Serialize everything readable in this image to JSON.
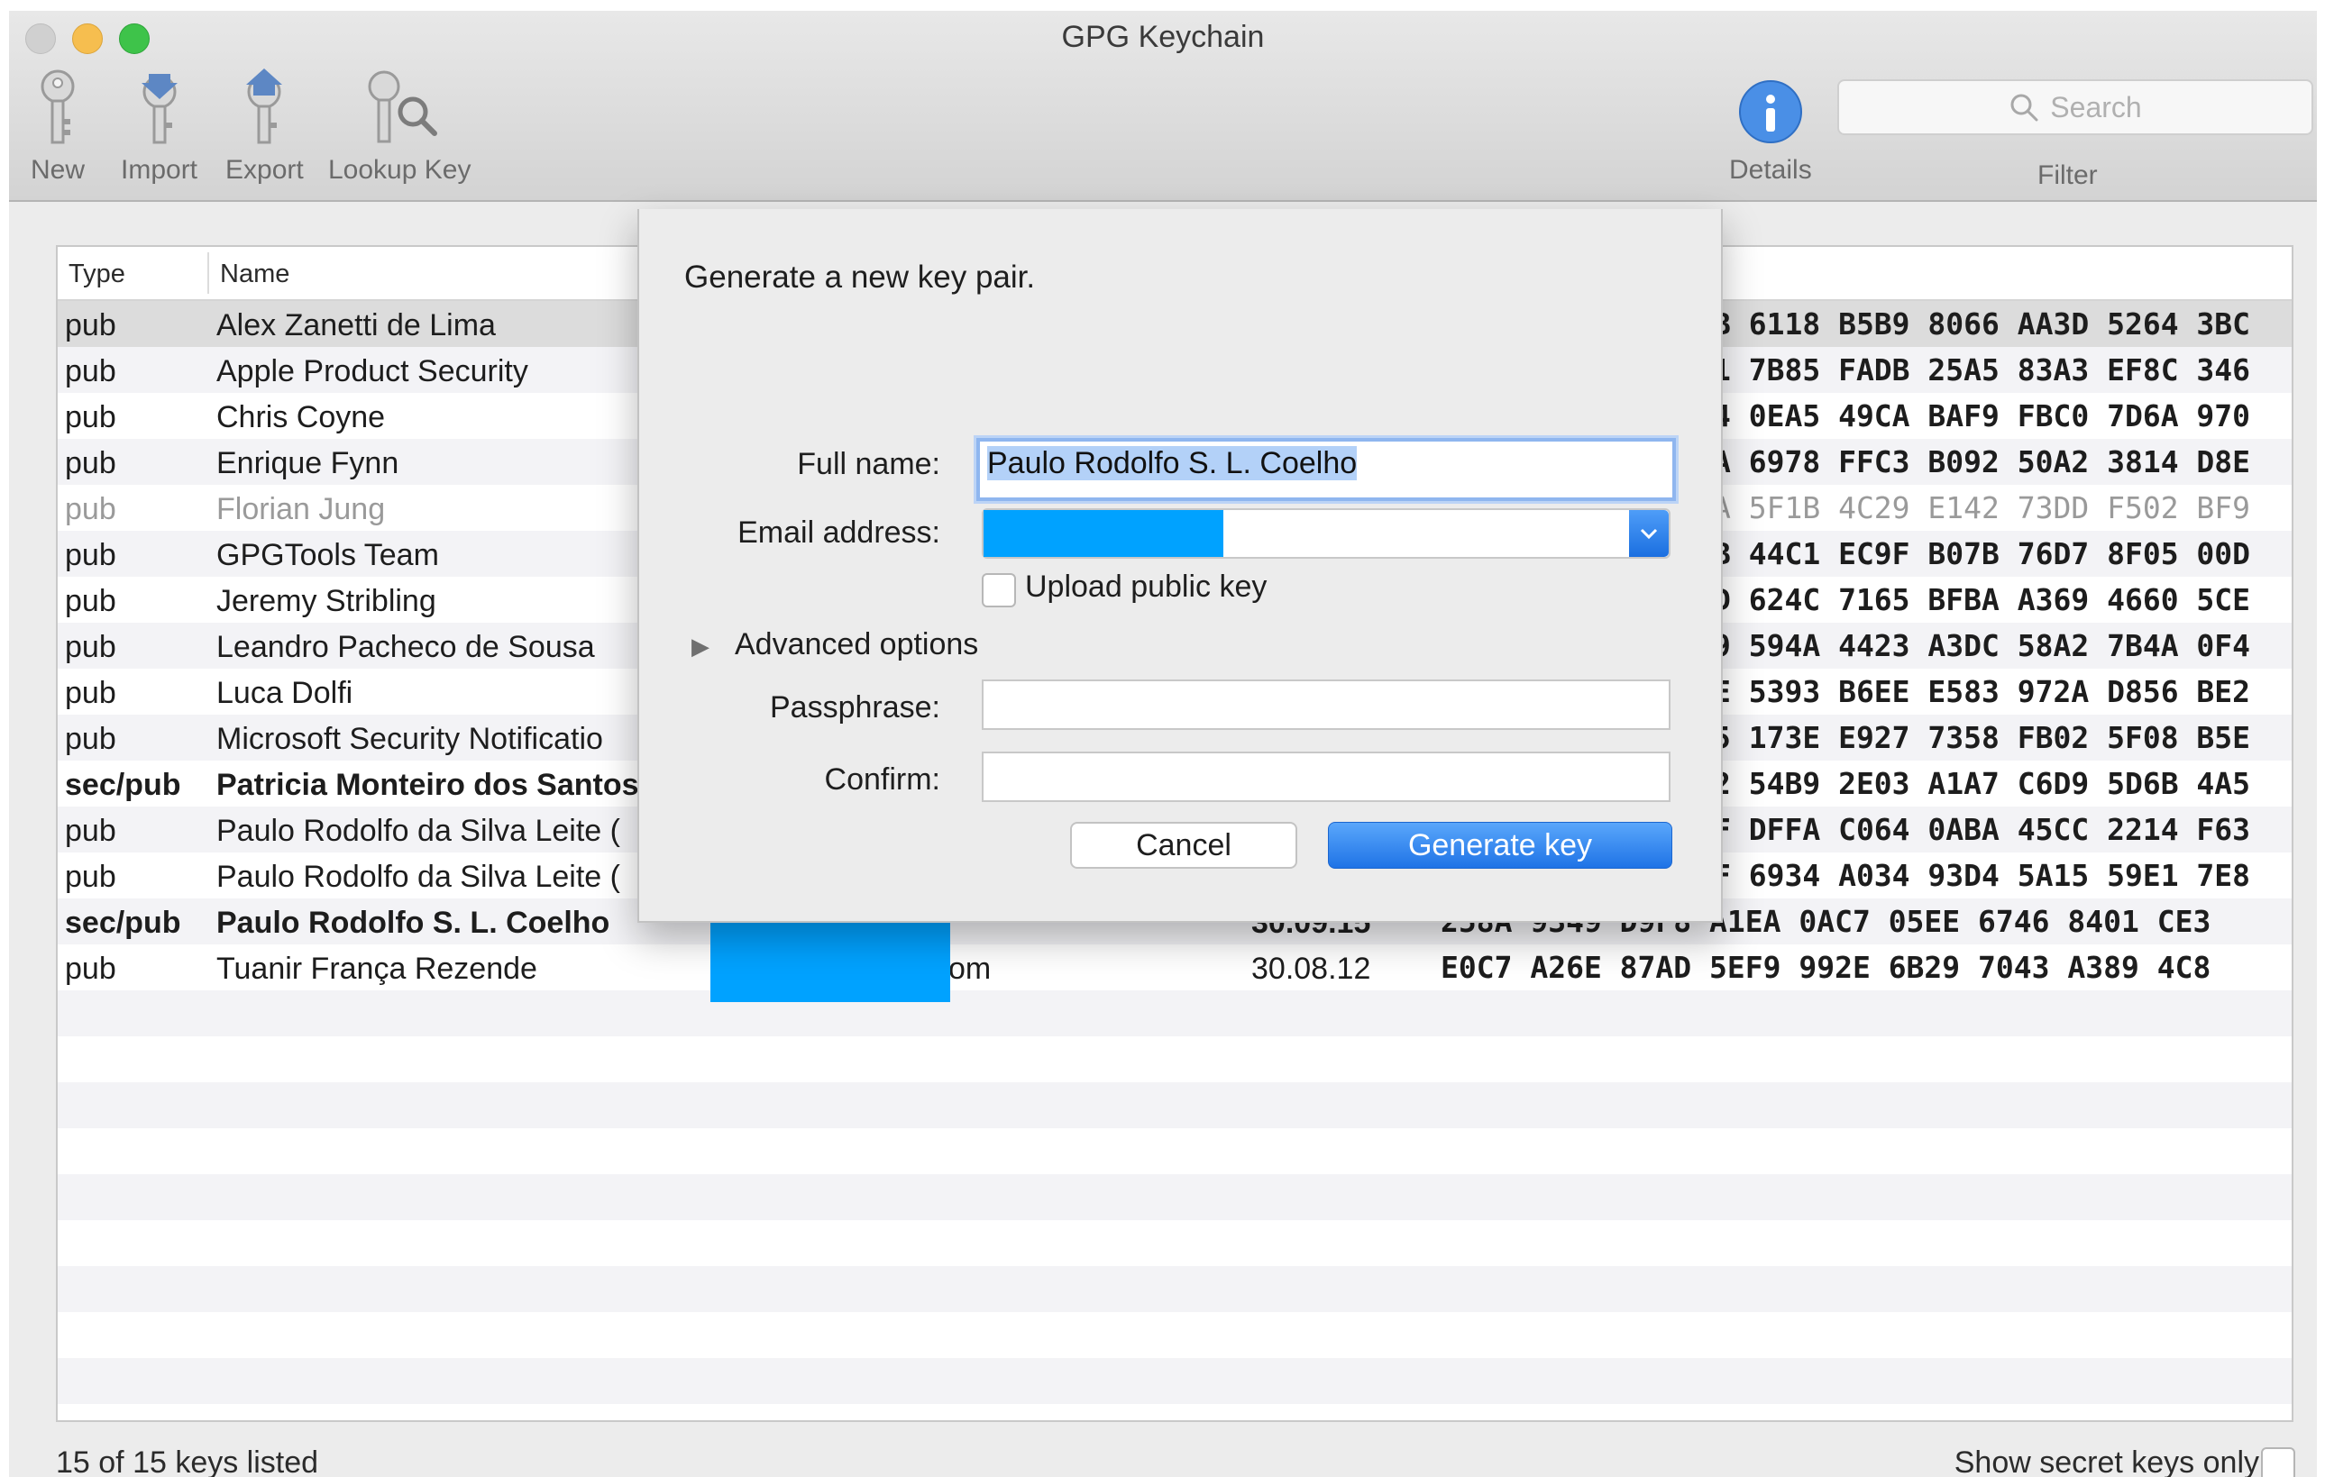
{
  "window": {
    "title": "GPG Keychain"
  },
  "toolbar": {
    "new_label": "New",
    "import_label": "Import",
    "export_label": "Export",
    "lookup_label": "Lookup Key",
    "details_label": "Details",
    "search_placeholder": "Search",
    "filter_label": "Filter"
  },
  "table": {
    "headers": {
      "type": "Type",
      "name": "Name"
    },
    "rows": [
      {
        "type": "pub",
        "name": "Alex Zanetti de Lima",
        "date": "",
        "fingerprint": "B 6118 B5B9  8066 AA3D 5264 3BC"
      },
      {
        "type": "pub",
        "name": "Apple Product Security",
        "date": "",
        "fingerprint": "1 7B85 FADB  25A5 83A3 EF8C 346"
      },
      {
        "type": "pub",
        "name": "Chris Coyne",
        "date": "",
        "fingerprint": "4 0EA5 49CA  BAF9 FBC0 7D6A 970"
      },
      {
        "type": "pub",
        "name": "Enrique Fynn",
        "date": "",
        "fingerprint": "A 6978 FFC3  B092 50A2 3814 D8E"
      },
      {
        "type": "pub",
        "name": "Florian Jung",
        "date": "",
        "fingerprint": "A 5F1B 4C29  E142 73DD F502 BF9"
      },
      {
        "type": "pub",
        "name": "GPGTools Team",
        "date": "",
        "fingerprint": "B 44C1 EC9F  B07B 76D7 8F05 00D"
      },
      {
        "type": "pub",
        "name": "Jeremy Stribling",
        "date": "",
        "fingerprint": "D 624C 7165  BFBA A369 4660 5CE"
      },
      {
        "type": "pub",
        "name": "Leandro Pacheco de Sousa",
        "date": "",
        "fingerprint": "9 594A 4423  A3DC 58A2 7B4A 0F4"
      },
      {
        "type": "pub",
        "name": "Luca Dolfi",
        "date": "",
        "fingerprint": "E 5393 B6EE  E583 972A D856 BE2"
      },
      {
        "type": "pub",
        "name": "Microsoft Security Notificatio",
        "date": "",
        "fingerprint": "5 173E E927  7358 FB02 5F08 B5E"
      },
      {
        "type": "sec/pub",
        "name": "Patricia Monteiro dos Santos",
        "date": "",
        "fingerprint": "2 54B9 2E03  A1A7 C6D9 5D6B 4A5"
      },
      {
        "type": "pub",
        "name": "Paulo Rodolfo da Silva Leite (",
        "date": "",
        "fingerprint": "F DFFA C064  0ABA 45CC 2214 F63"
      },
      {
        "type": "pub",
        "name": "Paulo Rodolfo da Silva Leite (",
        "date": "",
        "fingerprint": "F 6934 A034  93D4 5A15 59E1 7E8"
      },
      {
        "type": "sec/pub",
        "name": "Paulo Rodolfo S. L. Coelho",
        "date": "30.09.15",
        "fingerprint": "258A 9349 D9F8 A1EA 0AC7  05EE 6746 8401 CE3"
      },
      {
        "type": "pub",
        "name": "Tuanir França Rezende",
        "date": "30.08.12",
        "fingerprint": "E0C7 A26E 87AD 5EF9 992E  6B29 7043 A389 4C8"
      }
    ],
    "email_fragment": "om"
  },
  "status": {
    "count": "15 of 15 keys listed",
    "secret_only_label": "Show secret keys only"
  },
  "dialog": {
    "title": "Generate a new key pair.",
    "full_name_label": "Full name:",
    "full_name_value": "Paulo Rodolfo S. L. Coelho",
    "email_label": "Email address:",
    "upload_label": "Upload public key",
    "advanced_label": "Advanced options",
    "passphrase_label": "Passphrase:",
    "confirm_label": "Confirm:",
    "cancel_label": "Cancel",
    "generate_label": "Generate key"
  },
  "colors": {
    "accent": "#1f73e6",
    "redaction": "#00a2ff",
    "focus_ring": "#8fb6ef"
  }
}
